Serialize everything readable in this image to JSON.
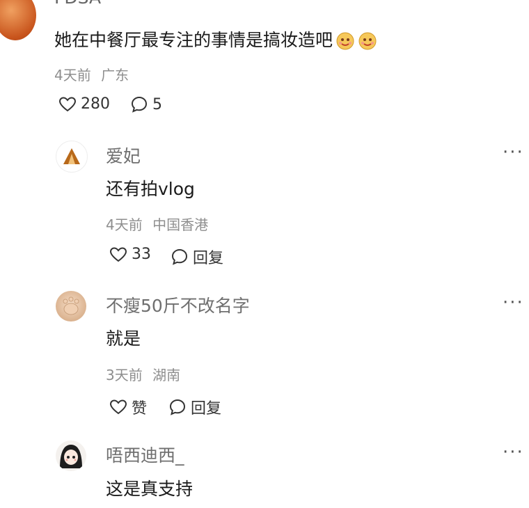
{
  "comments": [
    {
      "username": "FDSA",
      "text": "她在中餐厅最专注的事情是搞妆造吧",
      "emojis": [
        "face-emoji",
        "face-emoji"
      ],
      "time": "4天前",
      "location": "广东",
      "likes": "280",
      "replies": "5"
    },
    {
      "username": "爱妃",
      "text": "还有拍vlog",
      "time": "4天前",
      "location": "中国香港",
      "likes": "33",
      "reply_label": "回复"
    },
    {
      "username": "不瘦50斤不改名字",
      "text": "就是",
      "time": "3天前",
      "location": "湖南",
      "likes": "赞",
      "reply_label": "回复"
    },
    {
      "username": "唔西迪西_",
      "text": "这是真支持"
    }
  ],
  "more_label": "···"
}
